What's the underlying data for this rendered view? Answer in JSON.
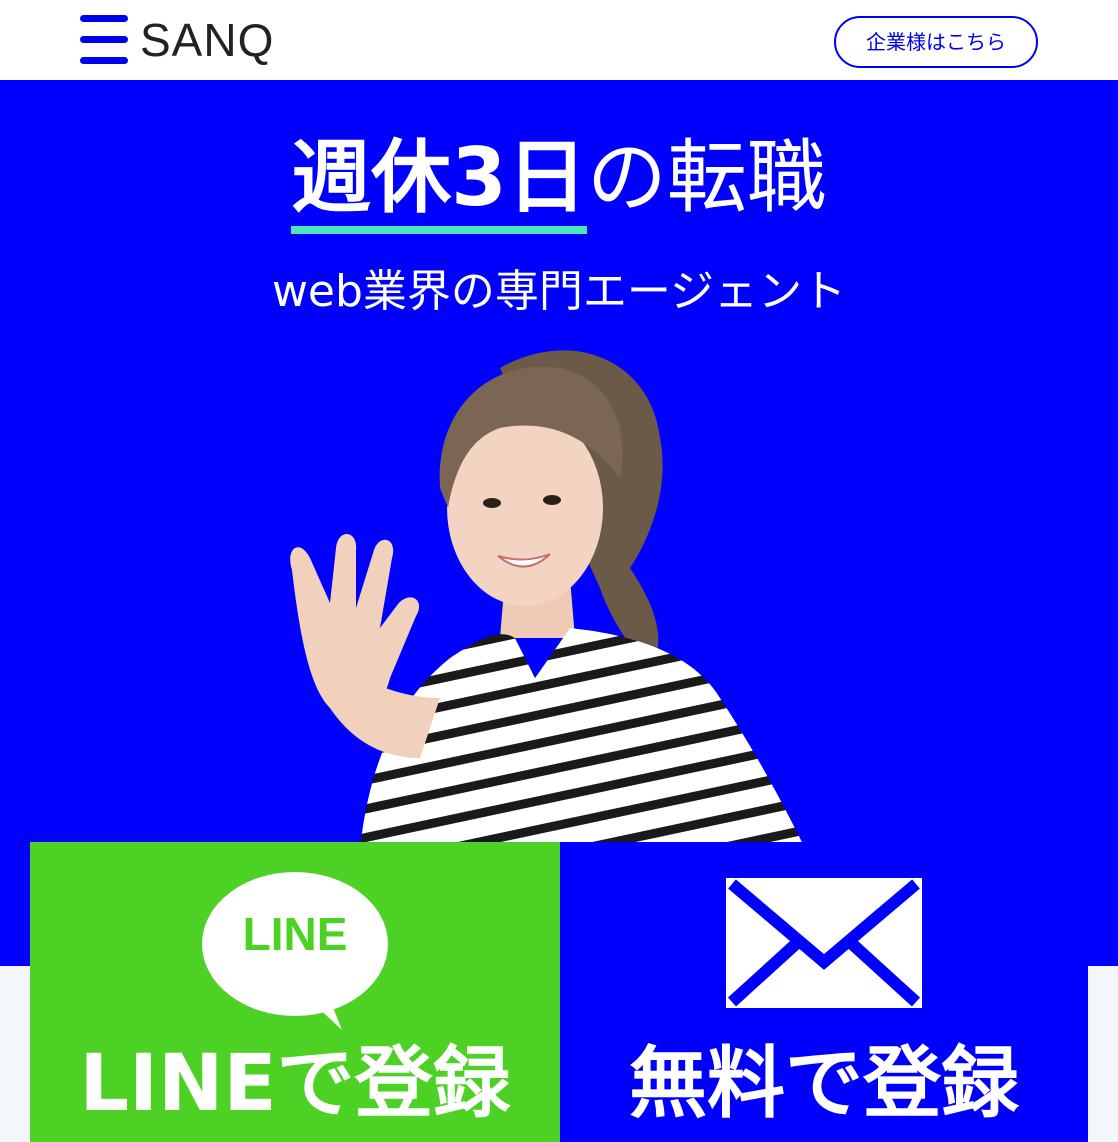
{
  "header": {
    "logo_text": "SANQ",
    "corporate_button_label": "企業様はこちら"
  },
  "hero": {
    "title_highlight": "週休3日",
    "title_rest": "の転職",
    "subtitle": "web業界の専門エージェント",
    "photo_description_icon": "woman-waving-photo"
  },
  "cta": {
    "line_icon_text": "LINE",
    "line_label": "LINEで登録",
    "mail_label": "無料で登録"
  },
  "colors": {
    "brand_blue": "#0000ff",
    "line_green": "#4cd124",
    "accent_mint": "#4ee6b8"
  }
}
